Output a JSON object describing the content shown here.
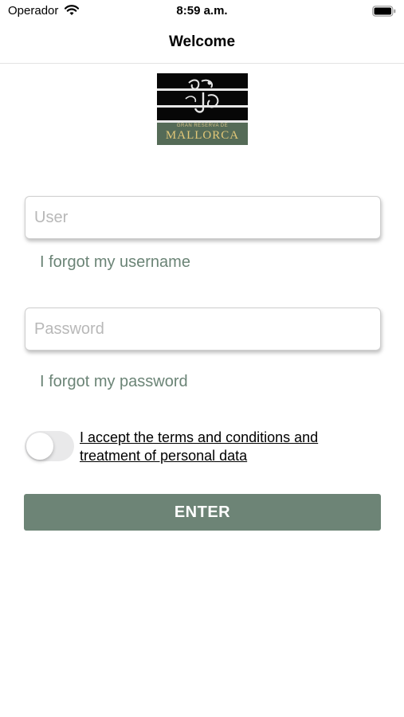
{
  "status_bar": {
    "carrier": "Operador",
    "time": "8:59 a.m."
  },
  "nav": {
    "title": "Welcome"
  },
  "logo": {
    "subtitle": "GRAN RESERVA DE",
    "title": "MALLORCA"
  },
  "form": {
    "user_placeholder": "User",
    "user_value": "",
    "forgot_username": "I forgot my username",
    "password_placeholder": "Password",
    "password_value": "",
    "forgot_password": "I forgot my password",
    "terms_toggle_on": false,
    "terms_text": "I accept the terms and conditions and treatment of personal data",
    "enter_label": "ENTER"
  },
  "colors": {
    "accent": "#6d8476",
    "link": "#6b8476",
    "toggle_off": "#e9e9ea"
  }
}
